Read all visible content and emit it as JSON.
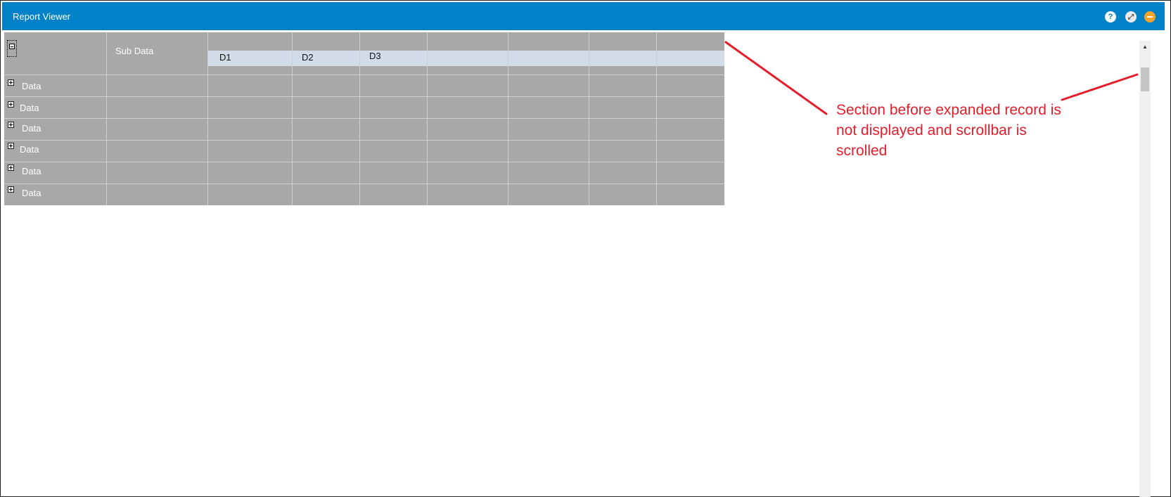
{
  "window": {
    "title": "Report Viewer",
    "help_glyph": "?",
    "expand_glyph": "⤢",
    "icons": [
      "help-icon",
      "expand-icon",
      "minimize-icon"
    ],
    "titlebar_color": "#0181c7"
  },
  "grid": {
    "header_label": "Sub Data",
    "columns": [
      "D1",
      "D2",
      "D3"
    ],
    "rows": [
      {
        "label": "Data"
      },
      {
        "label": "Data"
      },
      {
        "label": "Data"
      },
      {
        "label": "Data"
      },
      {
        "label": "Data"
      },
      {
        "label": "Data"
      }
    ]
  },
  "scrollbar": {
    "up_glyph": "▲"
  },
  "annotation": {
    "text": "Section before expanded record is not displayed and scrollbar is scrolled",
    "color": "#e31e2b"
  }
}
